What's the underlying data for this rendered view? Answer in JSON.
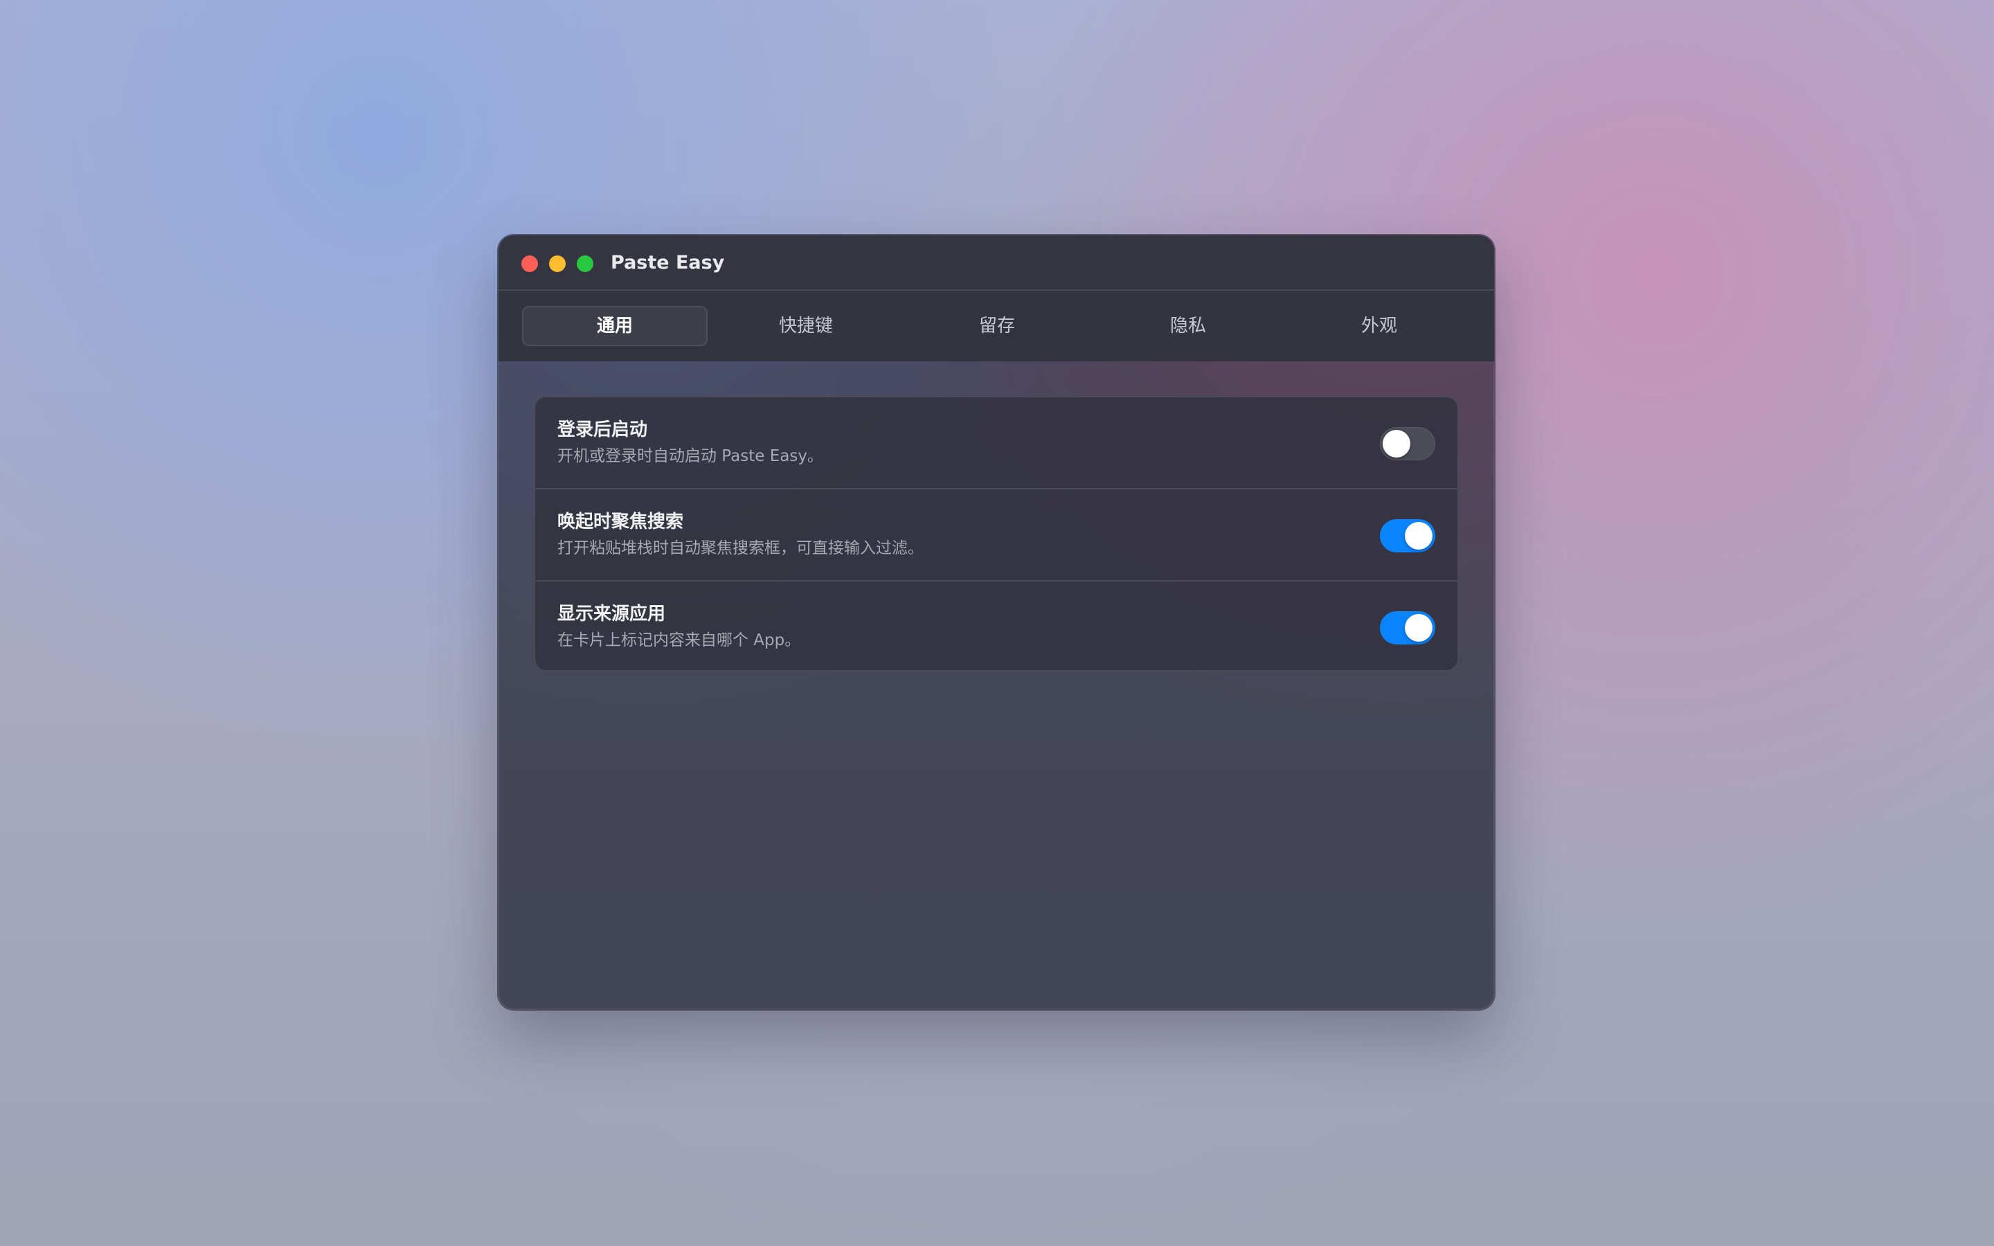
{
  "window": {
    "title": "Paste Easy"
  },
  "tabs": [
    {
      "label": "通用",
      "active": true
    },
    {
      "label": "快捷键",
      "active": false
    },
    {
      "label": "留存",
      "active": false
    },
    {
      "label": "隐私",
      "active": false
    },
    {
      "label": "外观",
      "active": false
    }
  ],
  "settings": [
    {
      "title": "登录后启动",
      "description": "开机或登录时自动启动 Paste Easy。",
      "enabled": false
    },
    {
      "title": "唤起时聚焦搜索",
      "description": "打开粘贴堆栈时自动聚焦搜索框，可直接输入过滤。",
      "enabled": true
    },
    {
      "title": "显示来源应用",
      "description": "在卡片上标记内容来自哪个 App。",
      "enabled": true
    }
  ],
  "colors": {
    "accent": "#0a84ff",
    "close": "#fe5f57",
    "minimize": "#febc2e",
    "maximize": "#28c840"
  }
}
